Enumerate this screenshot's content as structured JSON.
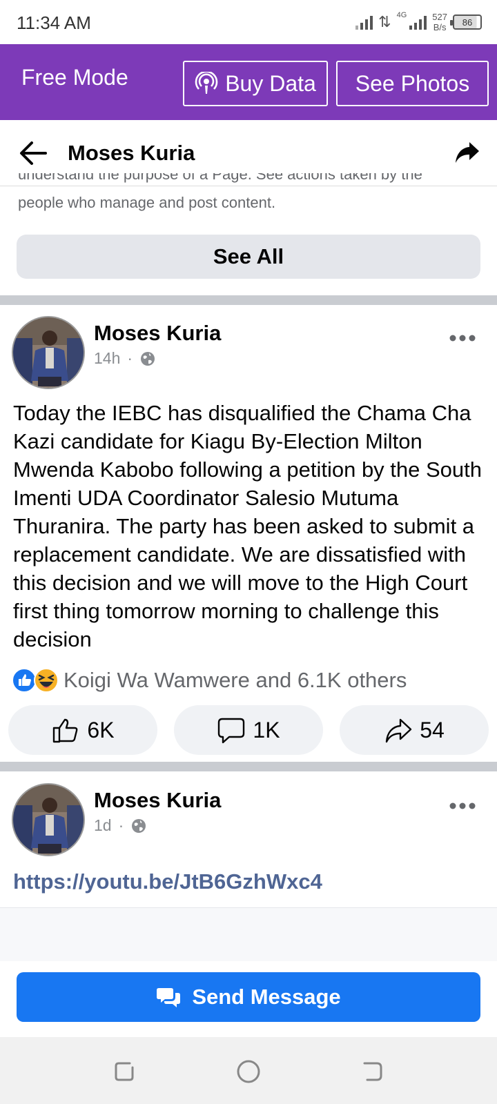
{
  "status_bar": {
    "time": "11:34 AM",
    "network_tag": "4G",
    "speed_value": "527",
    "speed_unit": "B/s",
    "battery": "86"
  },
  "free_mode_bar": {
    "title": "Free Mode",
    "buy_data_label": "Buy Data",
    "see_photos_label": "See Photos",
    "color": "#7d3ab8"
  },
  "header": {
    "title": "Moses Kuria"
  },
  "transparency": {
    "text_partial": "understand the purpose of a Page. See actions taken by the",
    "text": "people who manage and post content.",
    "see_all_label": "See All"
  },
  "posts": [
    {
      "author": "Moses Kuria",
      "time": "14h",
      "separator": "·",
      "text": "Today the IEBC has disqualified the Chama Cha Kazi candidate for Kiagu By-Election Milton Mwenda Kabobo following a petition by the South Imenti UDA Coordinator Salesio Mutuma Thuranira. The party has been asked to submit a replacement candidate.  We are dissatisfied with this decision and we will move to the High Court first thing tomorrow morning to challenge this decision",
      "reactions_text": "Koigi Wa Wamwere and 6.1K others",
      "likes": "6K",
      "comments": "1K",
      "shares": "54"
    },
    {
      "author": "Moses Kuria",
      "time": "1d",
      "separator": "·",
      "link": "https://youtu.be/JtB6GzhWxc4"
    }
  ],
  "send_message": {
    "label": "Send Message",
    "color": "#1877f2"
  },
  "icons": {
    "back": "arrow-left-icon",
    "share": "share-arrow-icon",
    "globe": "globe-icon",
    "more": "more-dots-icon",
    "like": "thumbs-up-icon",
    "comment": "comment-bubble-icon",
    "share_post": "share-icon",
    "messenger": "chat-bubbles-icon"
  }
}
